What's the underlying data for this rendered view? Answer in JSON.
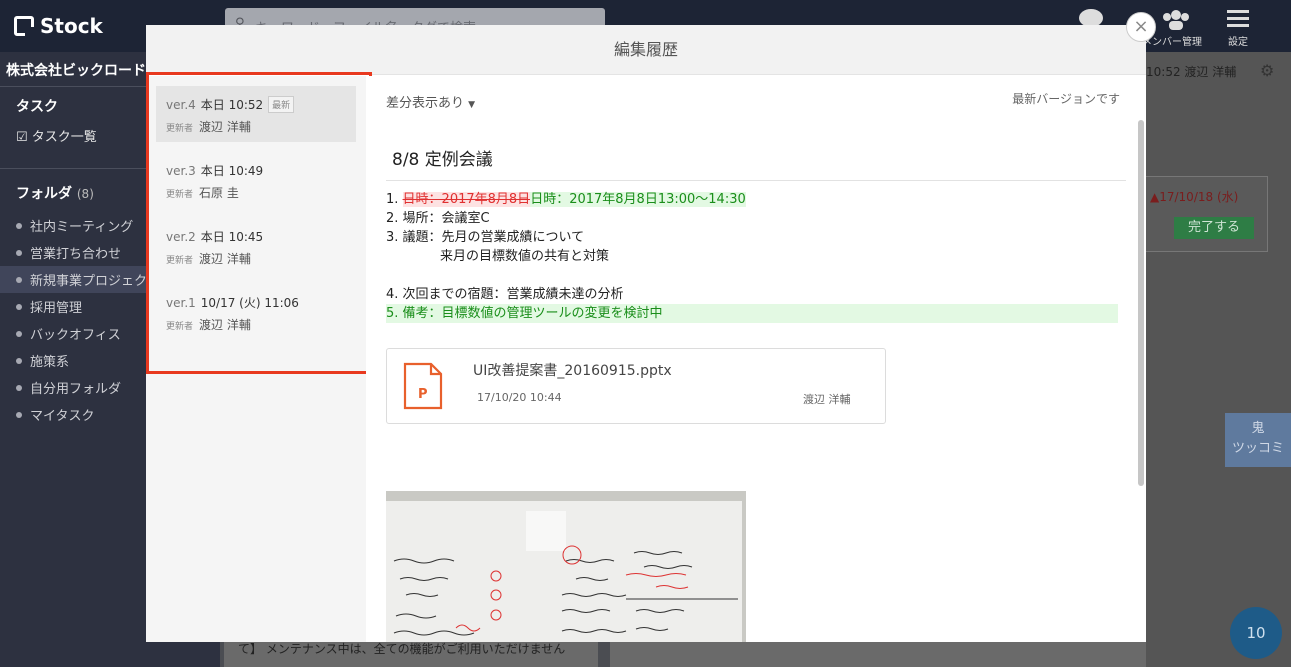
{
  "app": {
    "logo_text": "Stock",
    "search_placeholder": "キーワード・ファイル名・タグで検索",
    "top_members_label": "メンバー管理",
    "top_settings_label": "設定"
  },
  "sidebar": {
    "company": "株式会社ビックロード",
    "task_header": "タスク",
    "task_list": "タスク一覧",
    "folder_header": "フォルダ",
    "folder_count": "(8)",
    "folders": [
      {
        "label": "社内ミーティング"
      },
      {
        "label": "営業打ち合わせ"
      },
      {
        "label": "新規事業プロジェクト"
      },
      {
        "label": "採用管理"
      },
      {
        "label": "バックオフィス"
      },
      {
        "label": "施策系"
      },
      {
        "label": "自分用フォルダ"
      },
      {
        "label": "マイタスク"
      }
    ]
  },
  "background_right": {
    "meta": "10:52 渡辺 洋輔",
    "due_date": "17/10/18 (水)",
    "done_button": "完了する",
    "oni_button_line1": "鬼",
    "oni_button_line2": "ツッコミ",
    "badge_count": "10",
    "bottom_notice": "て】 メンテナンス中は、全ての機能がご利用いただけません"
  },
  "modal": {
    "title": "編集履歴",
    "close_glyph": "×",
    "versions": [
      {
        "ver": "ver.4",
        "time": "本日 10:52",
        "badge": "最新",
        "updater_label": "更新者",
        "updater": "渡辺 洋輔"
      },
      {
        "ver": "ver.3",
        "time": "本日 10:49",
        "badge": "",
        "updater_label": "更新者",
        "updater": "石原 圭"
      },
      {
        "ver": "ver.2",
        "time": "本日 10:45",
        "badge": "",
        "updater_label": "更新者",
        "updater": "渡辺 洋輔"
      },
      {
        "ver": "ver.1",
        "time": "10/17 (火) 11:06",
        "badge": "",
        "updater_label": "更新者",
        "updater": "渡辺 洋輔"
      }
    ],
    "diff_toggle": "差分表示あり",
    "latest_note": "最新バージョンです",
    "doc_title": "8/8 定例会議",
    "doc": {
      "line1_prefix": "1. ",
      "line1_deleted": "日時：2017年8月8日",
      "line1_inserted": "日時：2017年8月8日13:00〜14:30",
      "line2": "2. 場所：会議室C",
      "line3": "3. 議題：先月の営業成績について",
      "line4": "来月の目標数値の共有と対策",
      "line6": "4. 次回までの宿題：営業成績未達の分析",
      "line7": "5. 備考：目標数値の管理ツールの変更を検討中"
    },
    "attachment": {
      "name": "UI改善提案書_20160915.pptx",
      "date": "17/10/20 10:44",
      "author": "渡辺 洋輔",
      "icon_letter": "P"
    }
  }
}
